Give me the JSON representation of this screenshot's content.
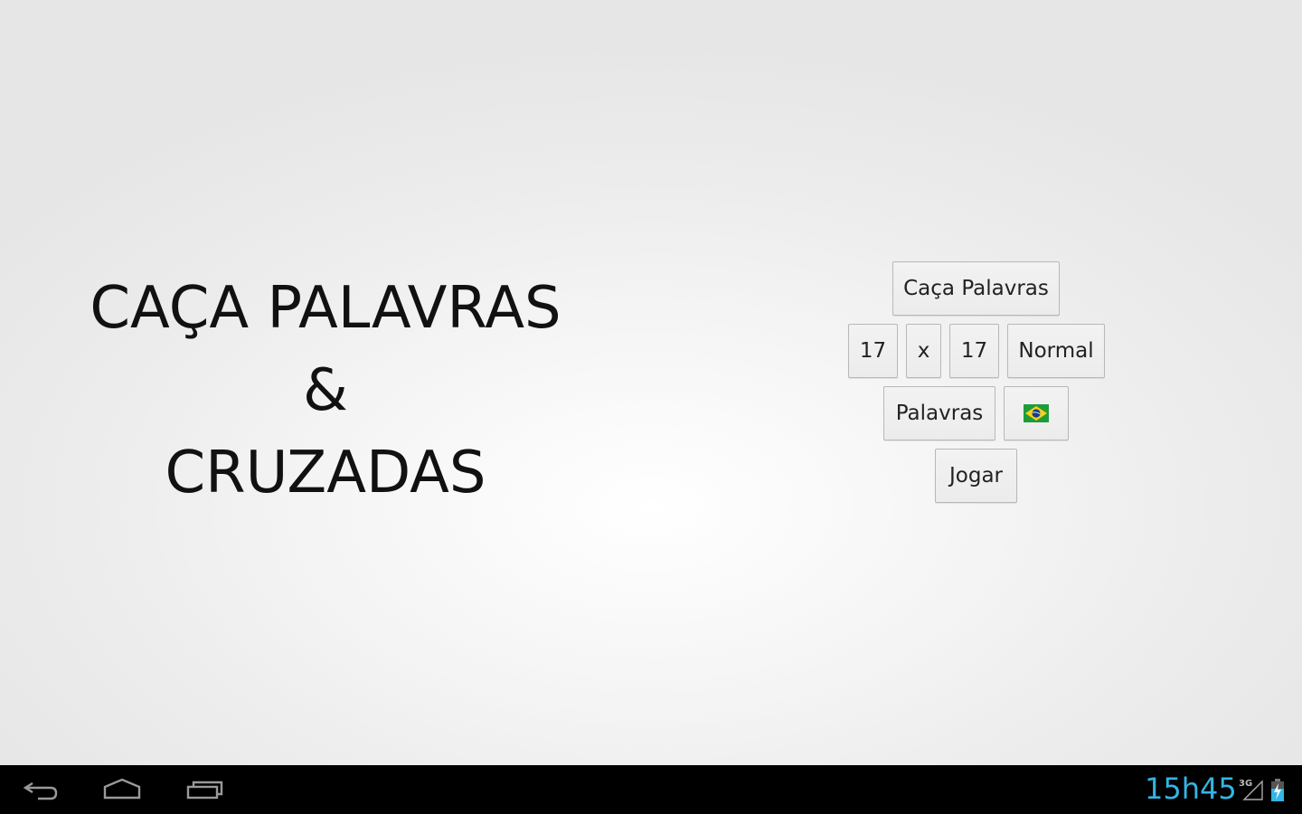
{
  "app": {
    "title_lines": [
      "CAÇA PALAVRAS",
      "&",
      "CRUZADAS"
    ]
  },
  "options": {
    "mode_button": "Caça Palavras",
    "rows_button": "17",
    "separator_button": "x",
    "cols_button": "17",
    "difficulty_button": "Normal",
    "category_button": "Palavras",
    "language_button_icon": "brazil-flag-icon",
    "play_button": "Jogar"
  },
  "system_bar": {
    "back_icon": "back-icon",
    "home_icon": "home-icon",
    "recents_icon": "recent-apps-icon",
    "clock": "15h45",
    "network_label": "3G",
    "colors": {
      "clock": "#33b5e5",
      "battery": "#33b5e5"
    }
  }
}
